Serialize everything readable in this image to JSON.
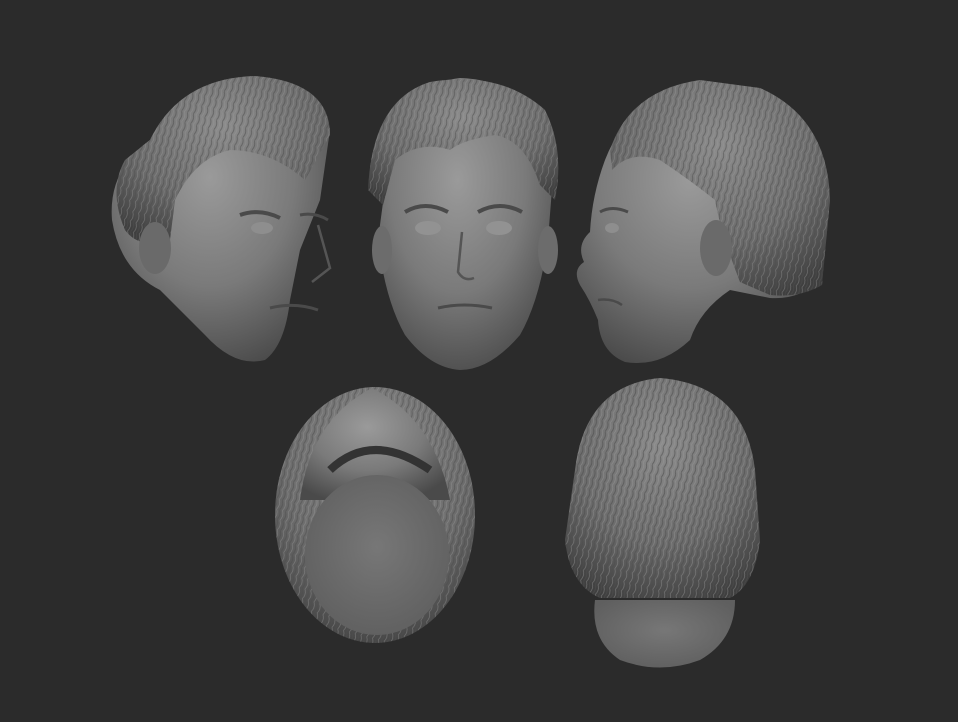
{
  "scene": {
    "background": "#2b2b2b",
    "material_color": "#7c7c7c",
    "views": [
      {
        "name": "three-quarter-left"
      },
      {
        "name": "front"
      },
      {
        "name": "profile-right"
      },
      {
        "name": "bottom"
      },
      {
        "name": "back"
      }
    ]
  }
}
